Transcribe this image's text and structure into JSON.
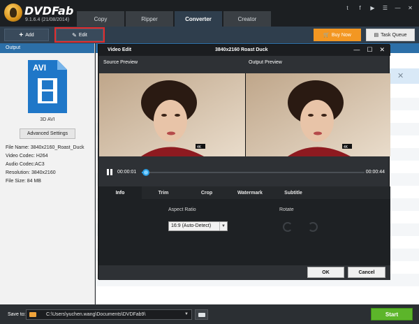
{
  "app": {
    "brand": "DVDFab",
    "version": "9.1.6.4 (21/08/2014)"
  },
  "tabs": [
    {
      "label": "Copy"
    },
    {
      "label": "Ripper"
    },
    {
      "label": "Converter",
      "active": true
    },
    {
      "label": "Creator"
    }
  ],
  "social_icons": [
    "twitter-icon",
    "facebook-icon",
    "youtube-icon",
    "feedback-icon",
    "minimize-icon",
    "close-icon"
  ],
  "social_glyphs": [
    "t",
    "f",
    "▶",
    "☰",
    "—",
    "✕"
  ],
  "toolbar": {
    "add_label": "Add",
    "edit_label": "Edit",
    "buy_label": "Buy Now",
    "queue_label": "Task Queue"
  },
  "output_panel": {
    "header": "Output",
    "format_ext": "AVI",
    "format_label": "3D AVI",
    "advanced_label": "Advanced Settings",
    "file_info": [
      "File Name: 3840x2160_Roast_Duck",
      "Video Codec: H264",
      "Audio Codec:AC3",
      "Resolution: 3840x2160",
      "File Size: 84 MB"
    ]
  },
  "dialog": {
    "title": "Video Edit",
    "resolution_title": "3840x2160  Roast  Duck",
    "source_label": "Source Preview",
    "output_label": "Output Preview",
    "time_current": "00:00:01",
    "time_total": "00:00:44",
    "progress": 0.02,
    "tabs": [
      {
        "label": "Info",
        "active": true
      },
      {
        "label": "Trim"
      },
      {
        "label": "Crop"
      },
      {
        "label": "Watermark"
      },
      {
        "label": "Subtitle"
      }
    ],
    "aspect_ratio_label": "Aspect Ratio",
    "rotate_label": "Rotate",
    "aspect_ratio_value": "16:9 (Auto-Detect)",
    "ok_label": "OK",
    "cancel_label": "Cancel",
    "watermark_badge": "4K"
  },
  "bottom": {
    "save_label": "Save to:",
    "path": "C:\\Users\\yuchen.wang\\Documents\\DVDFab9\\",
    "start_label": "Start"
  },
  "colors": {
    "accent_blue": "#2c6fa8",
    "buy_orange": "#f39722",
    "start_green": "#5cb52a",
    "edit_highlight": "#e32b2b"
  }
}
